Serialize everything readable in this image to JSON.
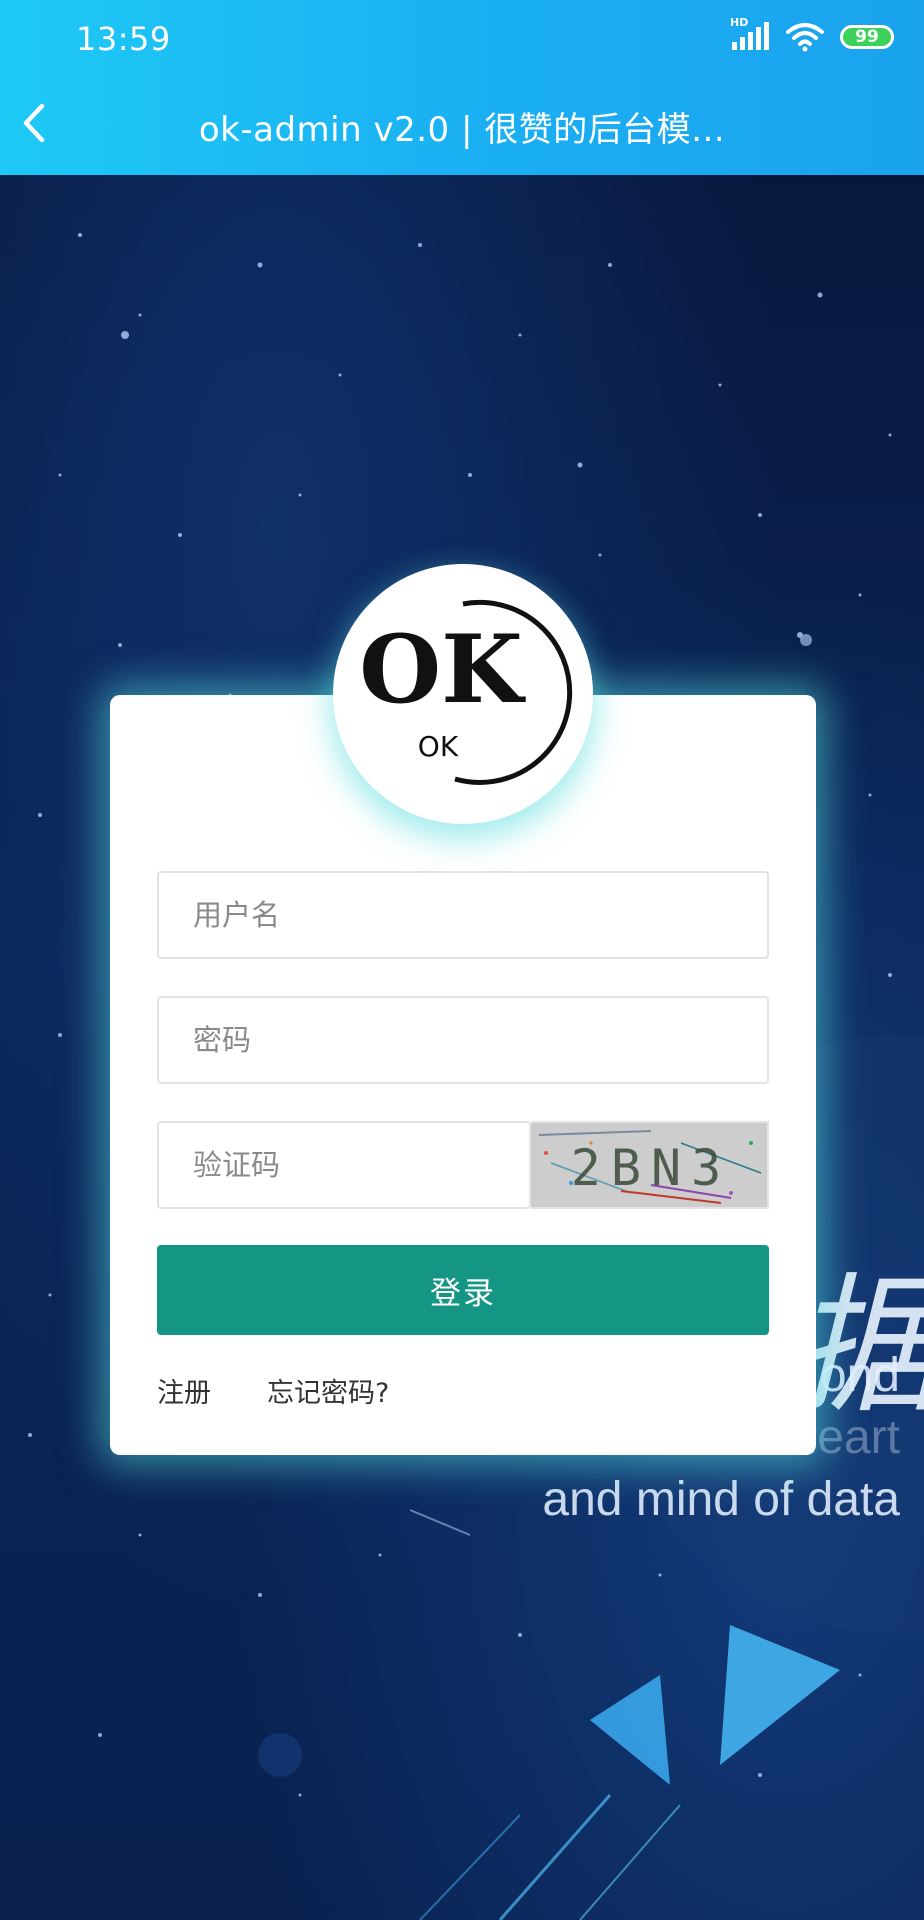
{
  "status_bar": {
    "time": "13:59",
    "network_label": "HD",
    "battery": "99"
  },
  "nav": {
    "back_icon": "chevron-left-icon",
    "title": "ok-admin v2.0 | 很赞的后台模..."
  },
  "logo": {
    "text_large": "OK",
    "text_small": "OK"
  },
  "form": {
    "username_placeholder": "用户名",
    "password_placeholder": "密码",
    "captcha_placeholder": "验证码",
    "captcha_text": "2BN3",
    "login_label": "登录"
  },
  "links": {
    "register": "注册",
    "forgot_password": "忘记密码?"
  },
  "background": {
    "glyph": "据",
    "text_lines": [
      "ond",
      "with the heart",
      "and mind of data"
    ]
  },
  "colors": {
    "header": "#1aaef2",
    "primary_button": "#159684",
    "glow": "#5ae6e6"
  }
}
